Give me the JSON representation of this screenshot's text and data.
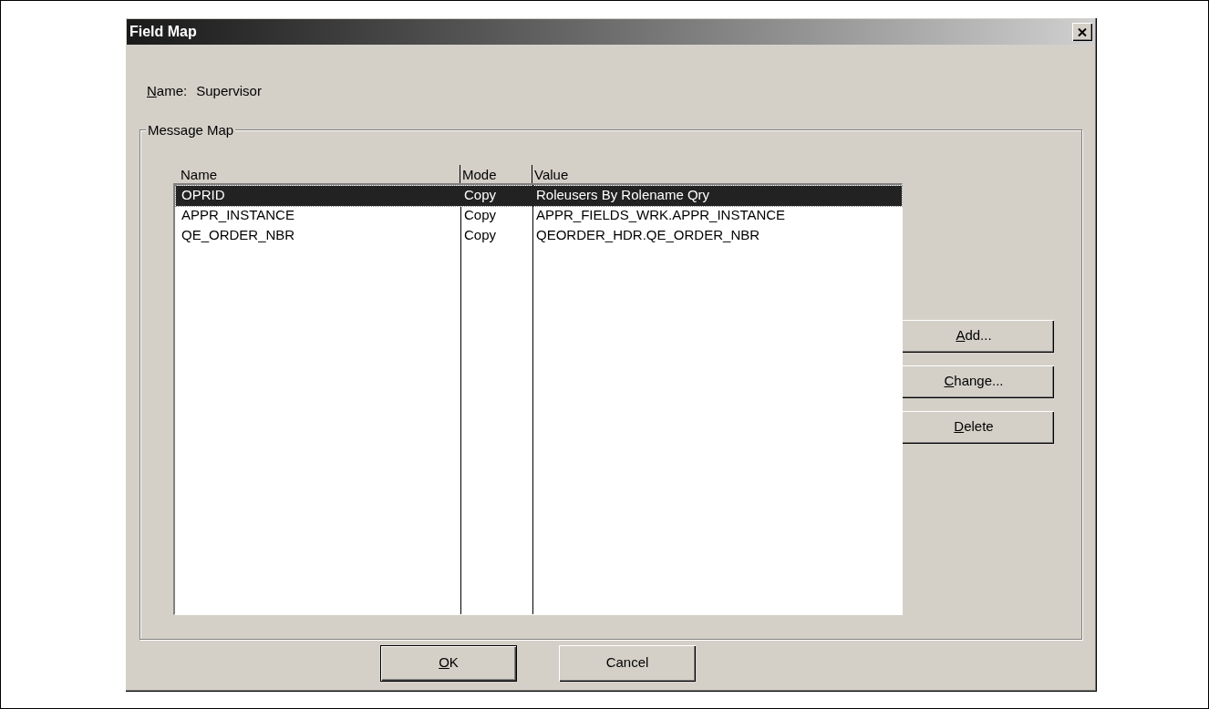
{
  "window": {
    "title": "Field Map"
  },
  "name_field": {
    "label": "Name:",
    "underline_first": true,
    "value": "Supervisor"
  },
  "group": {
    "title": "Message Map"
  },
  "table": {
    "columns": [
      "Name",
      "Mode",
      "Value"
    ],
    "rows": [
      {
        "cells": [
          "OPRID",
          "Copy",
          "Roleusers By Rolename Qry"
        ],
        "selected": true
      },
      {
        "cells": [
          "APPR_INSTANCE",
          "Copy",
          "APPR_FIELDS_WRK.APPR_INSTANCE"
        ],
        "selected": false
      },
      {
        "cells": [
          "QE_ORDER_NBR",
          "Copy",
          "QEORDER_HDR.QE_ORDER_NBR"
        ],
        "selected": false
      }
    ]
  },
  "side_buttons": [
    {
      "label": "Add...",
      "underline_first": true
    },
    {
      "label": "Change...",
      "underline_first": true
    },
    {
      "label": "Delete",
      "underline_first": true
    }
  ],
  "footer_buttons": [
    {
      "label": "OK",
      "underline_first": true,
      "default": true
    },
    {
      "label": "Cancel",
      "underline_first": false,
      "default": false
    }
  ]
}
